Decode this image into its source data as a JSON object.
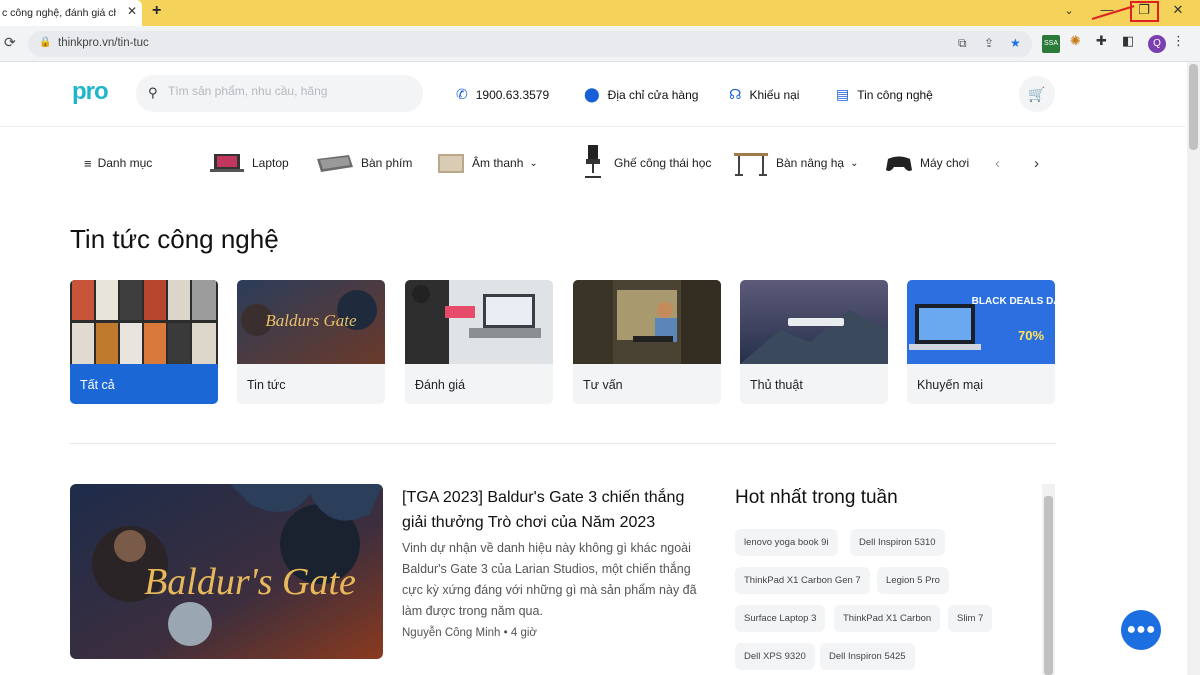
{
  "browser": {
    "tab_title": "c công nghệ, đánh giá chi",
    "tab_close": "✕",
    "new_tab": "+",
    "url": "thinkpro.vn/tin-tuc",
    "profile_initial": "Q",
    "minimize": "—",
    "restore": "❐",
    "close": "✕",
    "accent_color": "#f5d25a"
  },
  "header": {
    "logo": "pro",
    "search_placeholder": "Tìm sản phẩm, nhu cầu, hãng",
    "hotline": "1900.63.3579",
    "store_address": "Địa chỉ cửa hàng",
    "complaint": "Khiếu nại",
    "tech_news": "Tin công nghệ",
    "brand_color": "#1b67d6"
  },
  "categories": {
    "menu_label": "Danh mục",
    "items": [
      {
        "label": "Laptop"
      },
      {
        "label": "Bàn phím"
      },
      {
        "label": "Âm thanh"
      },
      {
        "label": "Ghế công thái học"
      },
      {
        "label": "Bàn nâng hạ"
      },
      {
        "label": "Máy chơi"
      }
    ]
  },
  "main": {
    "page_title": "Tin tức công nghệ",
    "news_tabs": [
      {
        "label": "Tất cả",
        "active": true
      },
      {
        "label": "Tin tức",
        "active": false
      },
      {
        "label": "Đánh giá",
        "active": false
      },
      {
        "label": "Tư vấn",
        "active": false
      },
      {
        "label": "Thủ thuật",
        "active": false
      },
      {
        "label": "Khuyến mại",
        "active": false
      }
    ],
    "card_images": {
      "baldurs": "Baldurs Gate",
      "black_deals_title": "BLACK DEALS DAY",
      "black_deals_badge": "70%"
    },
    "featured": {
      "title": "[TGA 2023] Baldur's Gate 3 chiến thắng giải thưởng Trò chơi của Năm 2023",
      "description": "Vinh dự nhận về danh hiệu này không gì khác ngoài Baldur's Gate 3 của Larian Studios, một chiến thắng cực kỳ xứng đáng với những gì mà sản phẩm này đã làm được trong năm qua.",
      "author": "Nguyễn Công Minh",
      "time": "4 giờ",
      "image_text": "Baldur's Gate"
    },
    "hot": {
      "title": "Hot nhất trong tuần",
      "tags": [
        "lenovo yoga book 9i",
        "Dell Inspiron 5310",
        "ThinkPad X1 Carbon Gen 7",
        "Legion 5 Pro",
        "Surface Laptop 3",
        "ThinkPad X1 Carbon",
        "Slim 7",
        "Dell XPS 9320",
        "Dell Inspiron 5425"
      ]
    }
  }
}
